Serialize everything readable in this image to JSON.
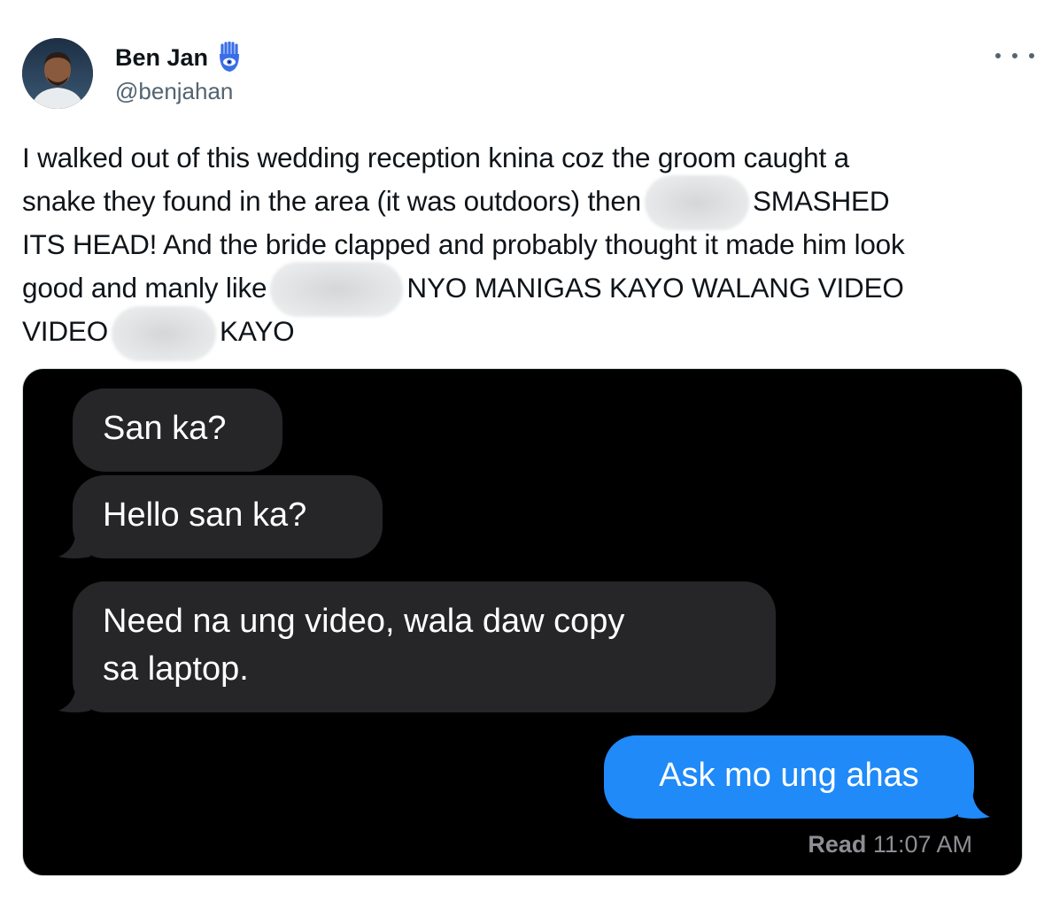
{
  "author": {
    "display_name": "Ben Jan",
    "handle": "@benjahan",
    "badge_icon": "hamsa-hand-icon",
    "badge_color": "#3a6ee8"
  },
  "more_icon": "ellipsis-icon",
  "tweet": {
    "line1": "I walked out of this wedding reception knina coz the groom caught a",
    "line2a": "snake they found in the area (it was outdoors) then",
    "line2b": "SMASHED",
    "line3": "ITS HEAD! And the bride clapped and probably thought it made him look",
    "line4a": "good and manly like",
    "line4b": "NYO MANIGAS KAYO WALANG VIDEO",
    "line5a": "VIDEO",
    "line5b": "KAYO"
  },
  "conversation": {
    "messages": [
      {
        "direction": "incoming",
        "text": "San ka?"
      },
      {
        "direction": "incoming",
        "text": "Hello san ka?"
      },
      {
        "direction": "incoming",
        "text_line1": "Need na ung video, wala daw copy",
        "text_line2": "sa laptop."
      },
      {
        "direction": "outgoing",
        "text": "Ask mo ung ahas"
      }
    ],
    "read_label": "Read",
    "read_time": "11:07 AM",
    "colors": {
      "background": "#000000",
      "incoming_bubble": "#262629",
      "outgoing_bubble": "#1f8af8"
    }
  }
}
